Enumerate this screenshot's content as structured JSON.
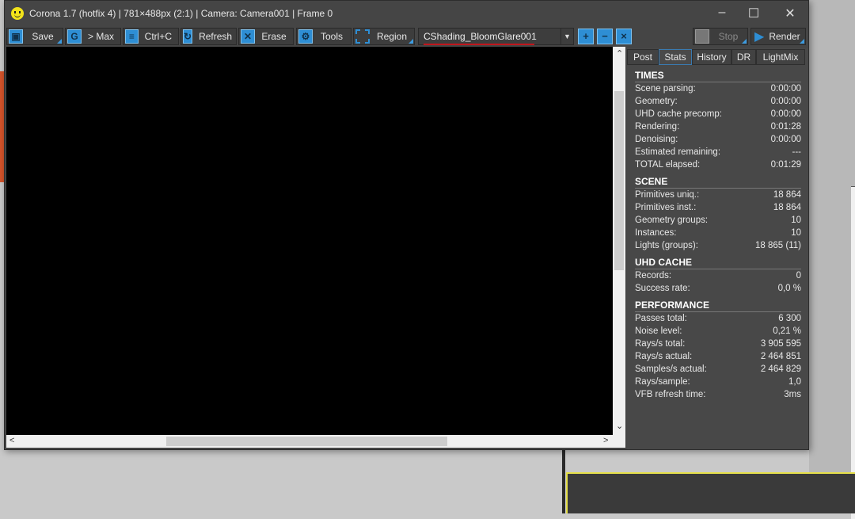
{
  "window": {
    "title": "Corona 1.7 (hotfix 4) | 781×488px (2:1) | Camera: Camera001 | Frame 0"
  },
  "toolbar": {
    "save": "Save",
    "max": "> Max",
    "copy": "Ctrl+C",
    "refresh": "Refresh",
    "erase": "Erase",
    "tools": "Tools",
    "region": "Region",
    "pass": "CShading_BloomGlare001",
    "stop": "Stop",
    "render": "Render"
  },
  "tabs": [
    "Post",
    "Stats",
    "History",
    "DR",
    "LightMix"
  ],
  "stats": [
    {
      "title": "TIMES",
      "rows": [
        [
          "Scene parsing:",
          "0:00:00"
        ],
        [
          "Geometry:",
          "0:00:00"
        ],
        [
          "UHD cache precomp:",
          "0:00:00"
        ],
        [
          "Rendering:",
          "0:01:28"
        ],
        [
          "Denoising:",
          "0:00:00"
        ],
        [
          "Estimated remaining:",
          "---"
        ],
        [
          "TOTAL elapsed:",
          "0:01:29"
        ]
      ]
    },
    {
      "title": "SCENE",
      "rows": [
        [
          "Primitives uniq.:",
          "18 864"
        ],
        [
          "Primitives inst.:",
          "18 864"
        ],
        [
          "Geometry groups:",
          "10"
        ],
        [
          "Instances:",
          "10"
        ],
        [
          "Lights (groups):",
          "18 865 (11)"
        ]
      ]
    },
    {
      "title": "UHD CACHE",
      "rows": [
        [
          "Records:",
          "0"
        ],
        [
          "Success rate:",
          "0,0 %"
        ]
      ]
    },
    {
      "title": "PERFORMANCE",
      "rows": [
        [
          "Passes total:",
          "6 300"
        ],
        [
          "Noise level:",
          "0,21 %"
        ],
        [
          "Rays/s total:",
          "3 905 595"
        ],
        [
          "Rays/s actual:",
          "2 464 851"
        ],
        [
          "Samples/s actual:",
          "2 464 829"
        ],
        [
          "Rays/sample:",
          "1,0"
        ],
        [
          "VFB refresh time:",
          "3ms"
        ]
      ]
    }
  ]
}
